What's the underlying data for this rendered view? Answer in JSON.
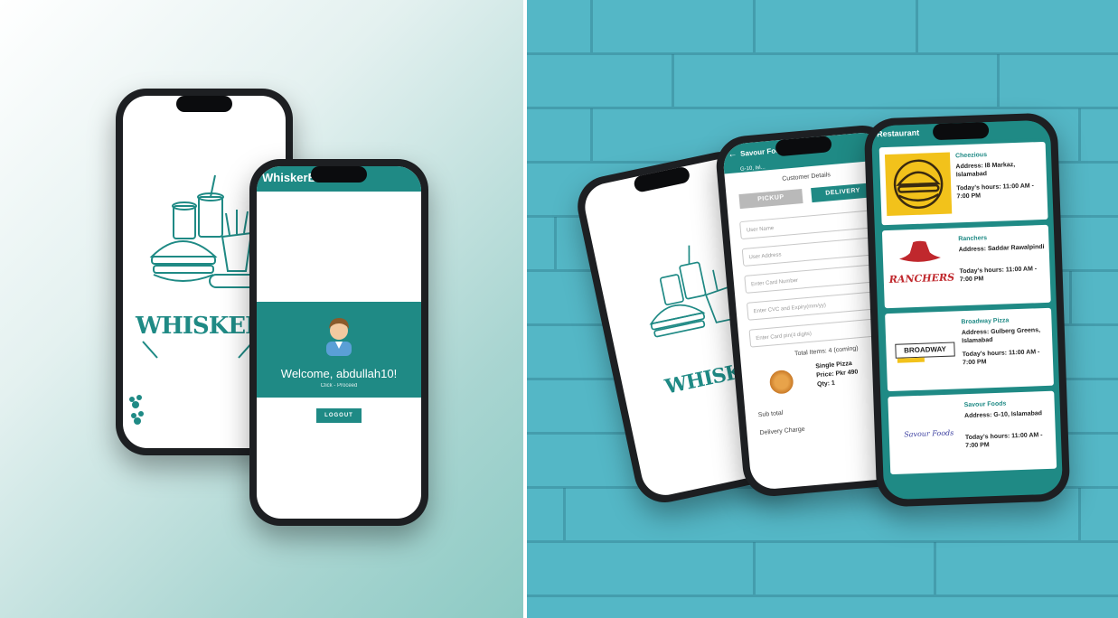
{
  "left_mockup": {
    "splash_brand": "WHISKERBIT",
    "appbar_title": "WhiskerBite",
    "welcome_text": "Welcome, abdullah10!",
    "welcome_subtext": "Click - Proceed",
    "logout_label": "LOGOUT"
  },
  "right_mockup": {
    "splash_brand": "WHISKERBIT",
    "checkout": {
      "appbar_title": "Savour Foods",
      "appbar_subtitle": "G-10, Isl...",
      "section_title": "Customer Details",
      "pickup_label": "PICKUP",
      "delivery_label": "DELIVERY",
      "fields": [
        "User Name",
        "User Address",
        "Enter Card Number",
        "Enter CVC and Expiry(mm/yy)",
        "Enter Card pin(4 digits)"
      ],
      "total_items_label": "Total Items: 4 (coming)",
      "item_name": "Single Pizza",
      "item_price": "Price: Pkr 490",
      "item_qty": "Qty: 1",
      "subtotal_label": "Sub total",
      "delivery_charge_label": "Delivery Charge"
    },
    "restaurants": {
      "appbar_title": "Restaurant",
      "items": [
        {
          "name": "Cheezious",
          "address": "Address: I8 Markaz, Islamabad",
          "hours": "Today's hours: 11:00 AM - 7:00 PM",
          "logo_text": ""
        },
        {
          "name": "Ranchers",
          "address": "Address: Saddar Rawalpindi",
          "hours": "Today's hours: 11:00 AM - 7:00 PM",
          "logo_text": "RANCHERS"
        },
        {
          "name": "Broadway Pizza",
          "address": "Address: Gulberg Greens, Islamabad",
          "hours": "Today's hours: 11:00 AM - 7:00 PM",
          "logo_text": "BROADWAY"
        },
        {
          "name": "Savour Foods",
          "address": "Address: G-10, Islamabad",
          "hours": "Today's hours: 11:00 AM - 7:00 PM",
          "logo_text": "Savour Foods"
        }
      ]
    }
  },
  "colors": {
    "teal": "#1f8a85",
    "wall": "#54b7c6",
    "cheezious_yellow": "#f2c21b"
  }
}
